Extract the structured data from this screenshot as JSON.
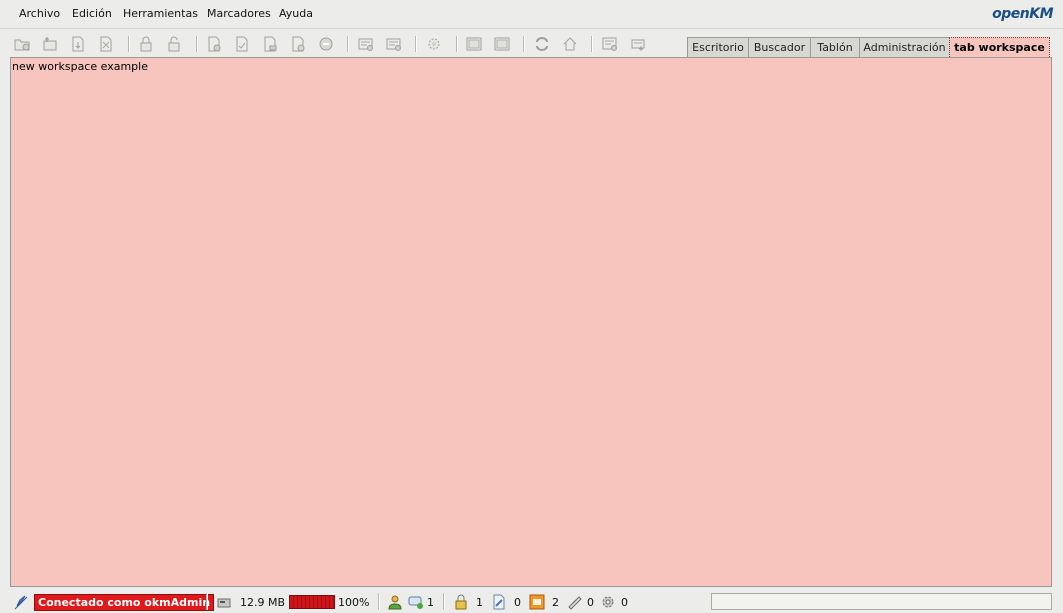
{
  "menu": {
    "items": [
      "Archivo",
      "Edición",
      "Herramientas",
      "Marcadores",
      "Ayuda"
    ]
  },
  "logo": {
    "main": "penKM",
    "prefix": "o"
  },
  "toolbar": {
    "icons": [
      "new-folder-icon",
      "add-document-icon",
      "download-icon",
      "download-pdf-icon",
      "lock-icon",
      "unlock-icon",
      "checkout-icon",
      "checkin-icon",
      "cancel-checkout-icon",
      "add-property-group-icon",
      "delete-icon",
      "workflow-icon",
      "remove-property-group-icon",
      "start-workflow-icon",
      "add-subscription-icon",
      "remove-subscription-icon",
      "refresh-icon",
      "home-icon",
      "scanner-icon",
      "uploader-icon"
    ]
  },
  "tabs": [
    "Escritorio",
    "Buscador",
    "Tablón",
    "Administración",
    "tab workspace"
  ],
  "workspace": {
    "text": "new workspace example"
  },
  "status": {
    "connected": "Conectado como okmAdmin",
    "used_space": "12.9 MB",
    "usage_percent": "100%",
    "usage_fraction": 1.0,
    "news_users": "1",
    "locked_docs": "1",
    "checkout_docs": "0",
    "subscribed_docs": "2",
    "subscribed_folders": "0",
    "workflow_tasks": "0",
    "colors": {
      "badge_bg": "#e0171b",
      "workspace_bg": "#f7c4be",
      "logo": "#1a4f86"
    }
  }
}
